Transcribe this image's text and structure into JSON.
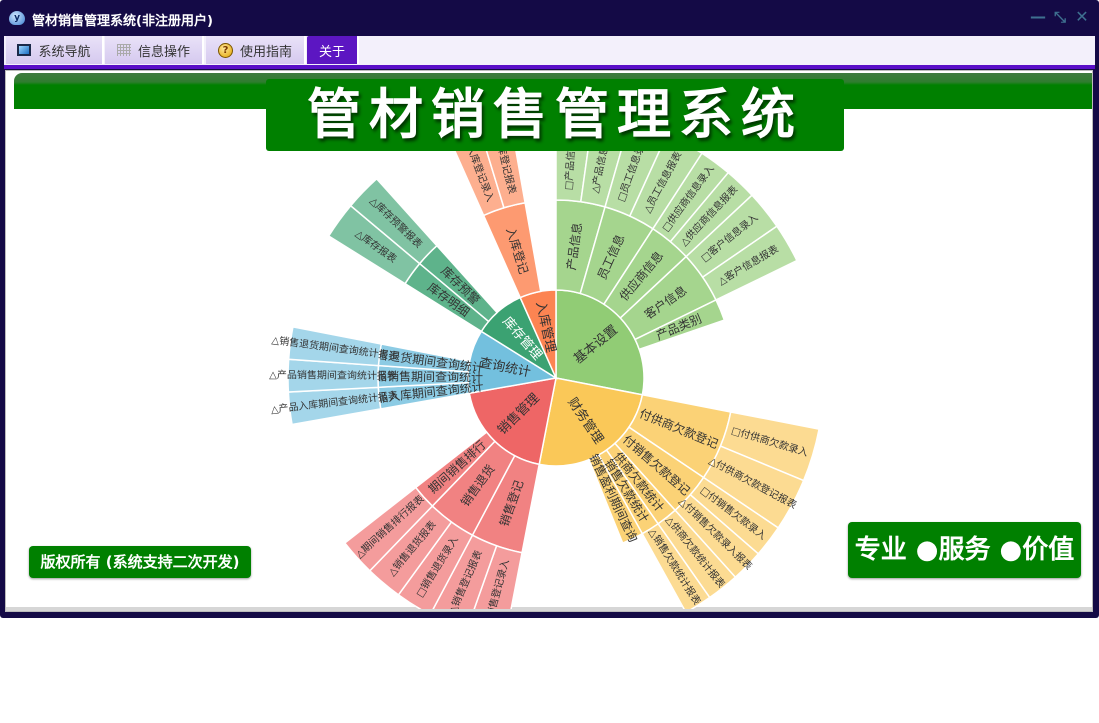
{
  "window": {
    "title": "管材销售管理系统(非注册用户)",
    "icon": "app-cloud-icon",
    "controls": [
      "minimize-icon",
      "restore-icon",
      "close-icon"
    ]
  },
  "tabs": [
    {
      "label": "系统导航",
      "icon": "monitor-icon"
    },
    {
      "label": "信息操作",
      "icon": "grid-icon"
    },
    {
      "label": "使用指南",
      "icon": "help-icon"
    },
    {
      "label": "关于",
      "active": true
    }
  ],
  "banner": {
    "title": "管材销售管理系统"
  },
  "footer": {
    "copyright": "版权所有 (系统支持二次开发)",
    "slogan": "专业 ●服务 ●价值"
  },
  "colors": {
    "titlebar": "#140a46",
    "accent": "#5a0fc8",
    "green": "#008000"
  },
  "chart_data": {
    "type": "sunburst",
    "total": 360,
    "series": [
      {
        "name": "基本设置",
        "value": 101,
        "color": "#91cc75",
        "children": [
          {
            "name": "产品信息",
            "value": 16,
            "children": [
              {
                "name": "□产品信息录入",
                "value": 8
              },
              {
                "name": "△产品信息报表",
                "value": 8
              }
            ]
          },
          {
            "name": "员工信息",
            "value": 17,
            "children": [
              {
                "name": "□员工信息录入",
                "value": 8.5
              },
              {
                "name": "△员工信息报表",
                "value": 8.5
              }
            ]
          },
          {
            "name": "供应商信息",
            "value": 14,
            "children": [
              {
                "name": "□供应商信息录入",
                "value": 7
              },
              {
                "name": "△供应商信息报表",
                "value": 7
              }
            ]
          },
          {
            "name": "客户信息",
            "value": 17,
            "children": [
              {
                "name": "□客户信息录入",
                "value": 8.5
              },
              {
                "name": "△客户信息报表",
                "value": 8.5
              }
            ]
          },
          {
            "name": "产品类别",
            "value": 7
          }
        ]
      },
      {
        "name": "财务管理",
        "value": 90,
        "color": "#fac858",
        "children": [
          {
            "name": "付供商欠款登记",
            "value": 23,
            "children": [
              {
                "name": "□付供商欠款录入",
                "value": 11.5
              },
              {
                "name": "△付供商欠款登记报表",
                "value": 11.5
              }
            ]
          },
          {
            "name": "付销售欠款登记",
            "value": 14,
            "children": [
              {
                "name": "□付销售欠款录入",
                "value": 7
              },
              {
                "name": "△付销售欠款录入报表",
                "value": 7
              }
            ]
          },
          {
            "name": "供商欠款统计",
            "value": 7,
            "children": [
              {
                "name": "△供商欠款统计报表",
                "value": 7
              }
            ]
          },
          {
            "name": "销售欠款统计",
            "value": 6,
            "children": [
              {
                "name": "△销售欠款统计报表",
                "value": 6
              }
            ]
          },
          {
            "name": "销售盈利期间查询",
            "value": 7
          }
        ]
      },
      {
        "name": "销售管理",
        "value": 69,
        "color": "#ee6666",
        "children": [
          {
            "name": "销售登记",
            "value": 17,
            "children": [
              {
                "name": "□销售登记录入",
                "value": 8.5
              },
              {
                "name": "△销售登记报表",
                "value": 8.5
              }
            ]
          },
          {
            "name": "销售退货",
            "value": 16,
            "children": [
              {
                "name": "□销售退货录入",
                "value": 8
              },
              {
                "name": "△销售退货报表",
                "value": 8
              }
            ]
          },
          {
            "name": "期间销售排行",
            "value": 8,
            "children": [
              {
                "name": "△期间销售排行报表",
                "value": 8
              }
            ]
          }
        ]
      },
      {
        "name": "查询统计",
        "value": 42,
        "color": "#73c0de",
        "children": [
          {
            "name": "产品入库期间查询统计",
            "value": 7,
            "children": [
              {
                "name": "△产品入库期间查询统计报表",
                "value": 7
              }
            ]
          },
          {
            "name": "产品销售期间查询统计",
            "value": 7,
            "children": [
              {
                "name": "△产品销售期间查询统计报表",
                "value": 7
              }
            ]
          },
          {
            "name": "销售退货期间查询统计",
            "value": 7,
            "children": [
              {
                "name": "△销售退货期间查询统计报表",
                "value": 7
              }
            ]
          }
        ]
      },
      {
        "name": "库存管理",
        "value": 34,
        "color": "#3ba272",
        "label_color": "#ffffff",
        "children": [
          {
            "name": "库存明细",
            "value": 8,
            "children": [
              {
                "name": "△库存报表",
                "value": 8
              }
            ]
          },
          {
            "name": "库存预警",
            "value": 8,
            "children": [
              {
                "name": "△库存预警报表",
                "value": 8
              }
            ]
          }
        ]
      },
      {
        "name": "入库管理",
        "value": 24,
        "color": "#fc8452",
        "children": [
          {
            "name": "入库登记",
            "value": 14,
            "children": [
              {
                "name": "□入库登记录入",
                "value": 7
              },
              {
                "name": "△入库登记报表",
                "value": 7
              }
            ]
          }
        ]
      }
    ]
  }
}
